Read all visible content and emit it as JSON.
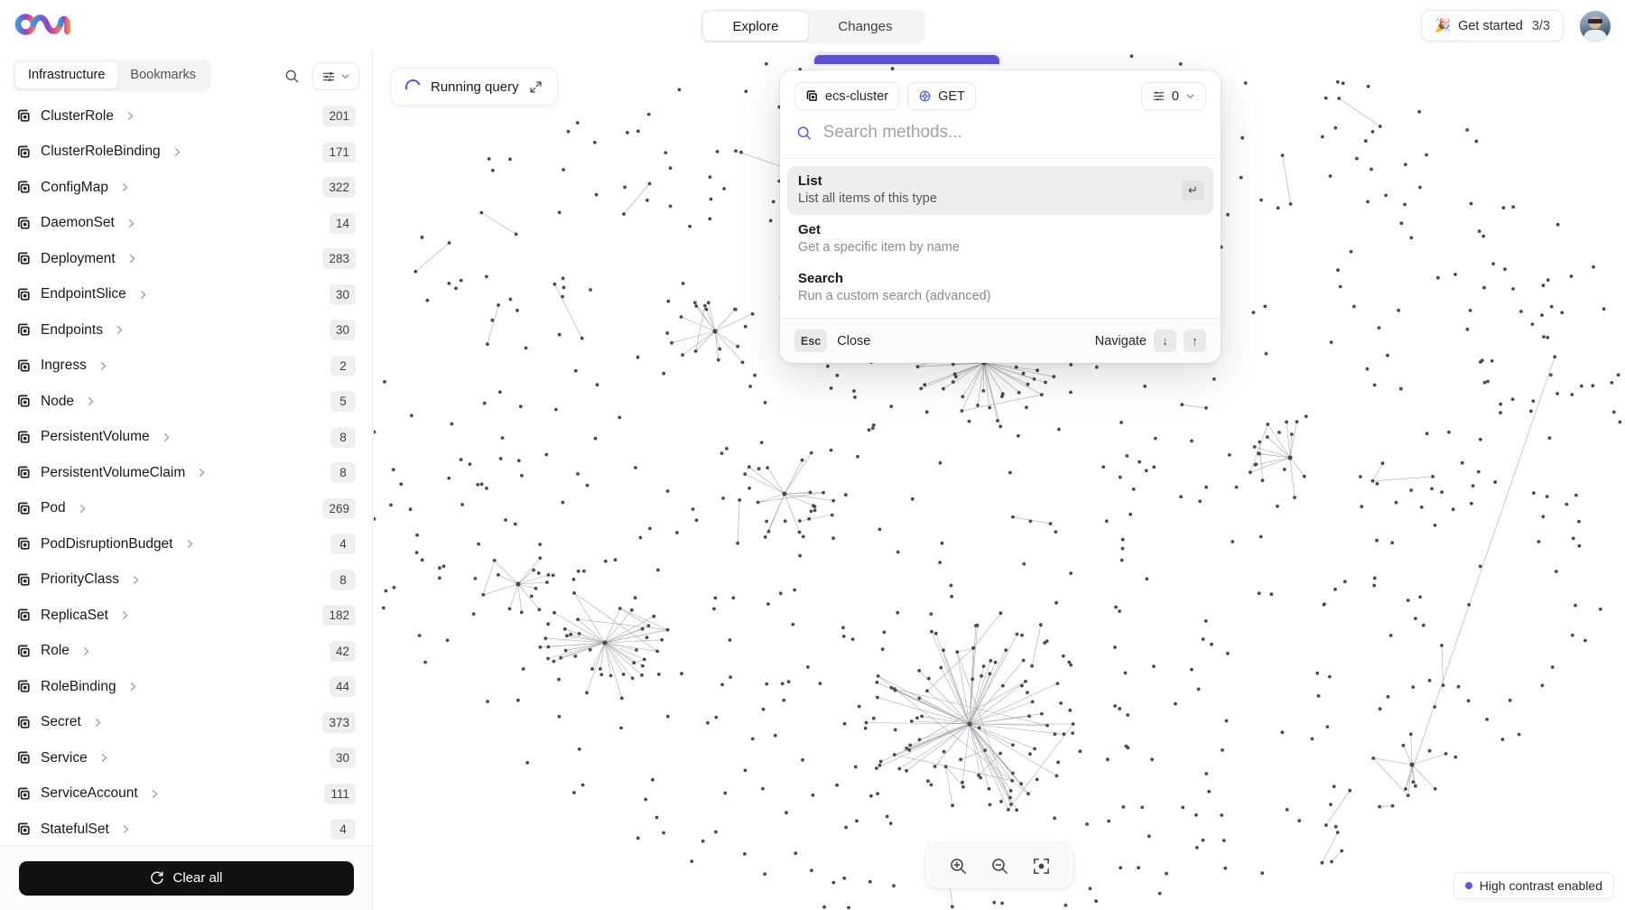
{
  "app": {
    "logo_name": "overmind-logo",
    "accent_color": "#5b52d9",
    "bg_color": "#ffffff"
  },
  "topbar": {
    "tabs": [
      {
        "label": "Explore",
        "active": true
      },
      {
        "label": "Changes",
        "active": false
      }
    ],
    "get_started": {
      "emoji": "🎉",
      "label": "Get started",
      "count": "3/3"
    },
    "avatar_name": "user-avatar"
  },
  "sidebar": {
    "tabs": [
      {
        "label": "Infrastructure",
        "active": true
      },
      {
        "label": "Bookmarks",
        "active": false
      }
    ],
    "search_icon": "search-icon",
    "filter_icon": "filter-sliders-icon",
    "filter_chevron": "chevron-down-icon",
    "items": [
      {
        "label": "ClusterRole",
        "count": "201"
      },
      {
        "label": "ClusterRoleBinding",
        "count": "171"
      },
      {
        "label": "ConfigMap",
        "count": "322"
      },
      {
        "label": "DaemonSet",
        "count": "14"
      },
      {
        "label": "Deployment",
        "count": "283"
      },
      {
        "label": "EndpointSlice",
        "count": "30"
      },
      {
        "label": "Endpoints",
        "count": "30"
      },
      {
        "label": "Ingress",
        "count": "2"
      },
      {
        "label": "Node",
        "count": "5"
      },
      {
        "label": "PersistentVolume",
        "count": "8"
      },
      {
        "label": "PersistentVolumeClaim",
        "count": "8"
      },
      {
        "label": "Pod",
        "count": "269"
      },
      {
        "label": "PodDisruptionBudget",
        "count": "4"
      },
      {
        "label": "PriorityClass",
        "count": "8"
      },
      {
        "label": "ReplicaSet",
        "count": "182"
      },
      {
        "label": "Role",
        "count": "42"
      },
      {
        "label": "RoleBinding",
        "count": "44"
      },
      {
        "label": "Secret",
        "count": "373"
      },
      {
        "label": "Service",
        "count": "30"
      },
      {
        "label": "ServiceAccount",
        "count": "111"
      },
      {
        "label": "StatefulSet",
        "count": "4"
      }
    ],
    "footer": {
      "clear_all_label": "Clear all",
      "clear_all_icon": "refresh-icon"
    }
  },
  "canvas": {
    "running_query": {
      "label": "Running query",
      "spinner_icon": "loading-spinner-icon",
      "expand_icon": "expand-diagonal-icon"
    },
    "zoom_controls": {
      "zoom_in_icon": "zoom-in-icon",
      "zoom_out_icon": "zoom-out-icon",
      "fit_icon": "focus-center-icon"
    },
    "high_contrast_badge": {
      "label": "High contrast enabled",
      "dot_color": "#6057d6"
    }
  },
  "palette": {
    "chips": [
      {
        "label": "ecs-cluster",
        "icon": "stack-layers-icon"
      },
      {
        "label": "GET",
        "icon": "gear-blue-icon"
      }
    ],
    "counter": {
      "icon": "list-settings-icon",
      "value": "0",
      "chevron": "chevron-down-icon"
    },
    "search": {
      "icon": "search-icon",
      "value": "",
      "placeholder": "Search methods..."
    },
    "methods": [
      {
        "title": "List",
        "subtitle": "List all items of this type",
        "selected": true,
        "enter_key": "↵"
      },
      {
        "title": "Get",
        "subtitle": "Get a specific item by name",
        "selected": false,
        "enter_key": ""
      },
      {
        "title": "Search",
        "subtitle": "Run a custom search (advanced)",
        "selected": false,
        "enter_key": ""
      }
    ],
    "footer": {
      "esc_key": "Esc",
      "close_label": "Close",
      "navigate_label": "Navigate",
      "down_key": "↓",
      "up_key": "↑"
    }
  },
  "chart_data": {
    "type": "scatter",
    "title": "Infrastructure dependency graph",
    "description": "Force-directed node-link graph of Kubernetes resources; hub-and-spoke clusters with many isolated nodes",
    "node_color": "#4a4a52",
    "edge_color": "#9a9aa2",
    "node_count_approx": 900,
    "hub_clusters": 9
  }
}
